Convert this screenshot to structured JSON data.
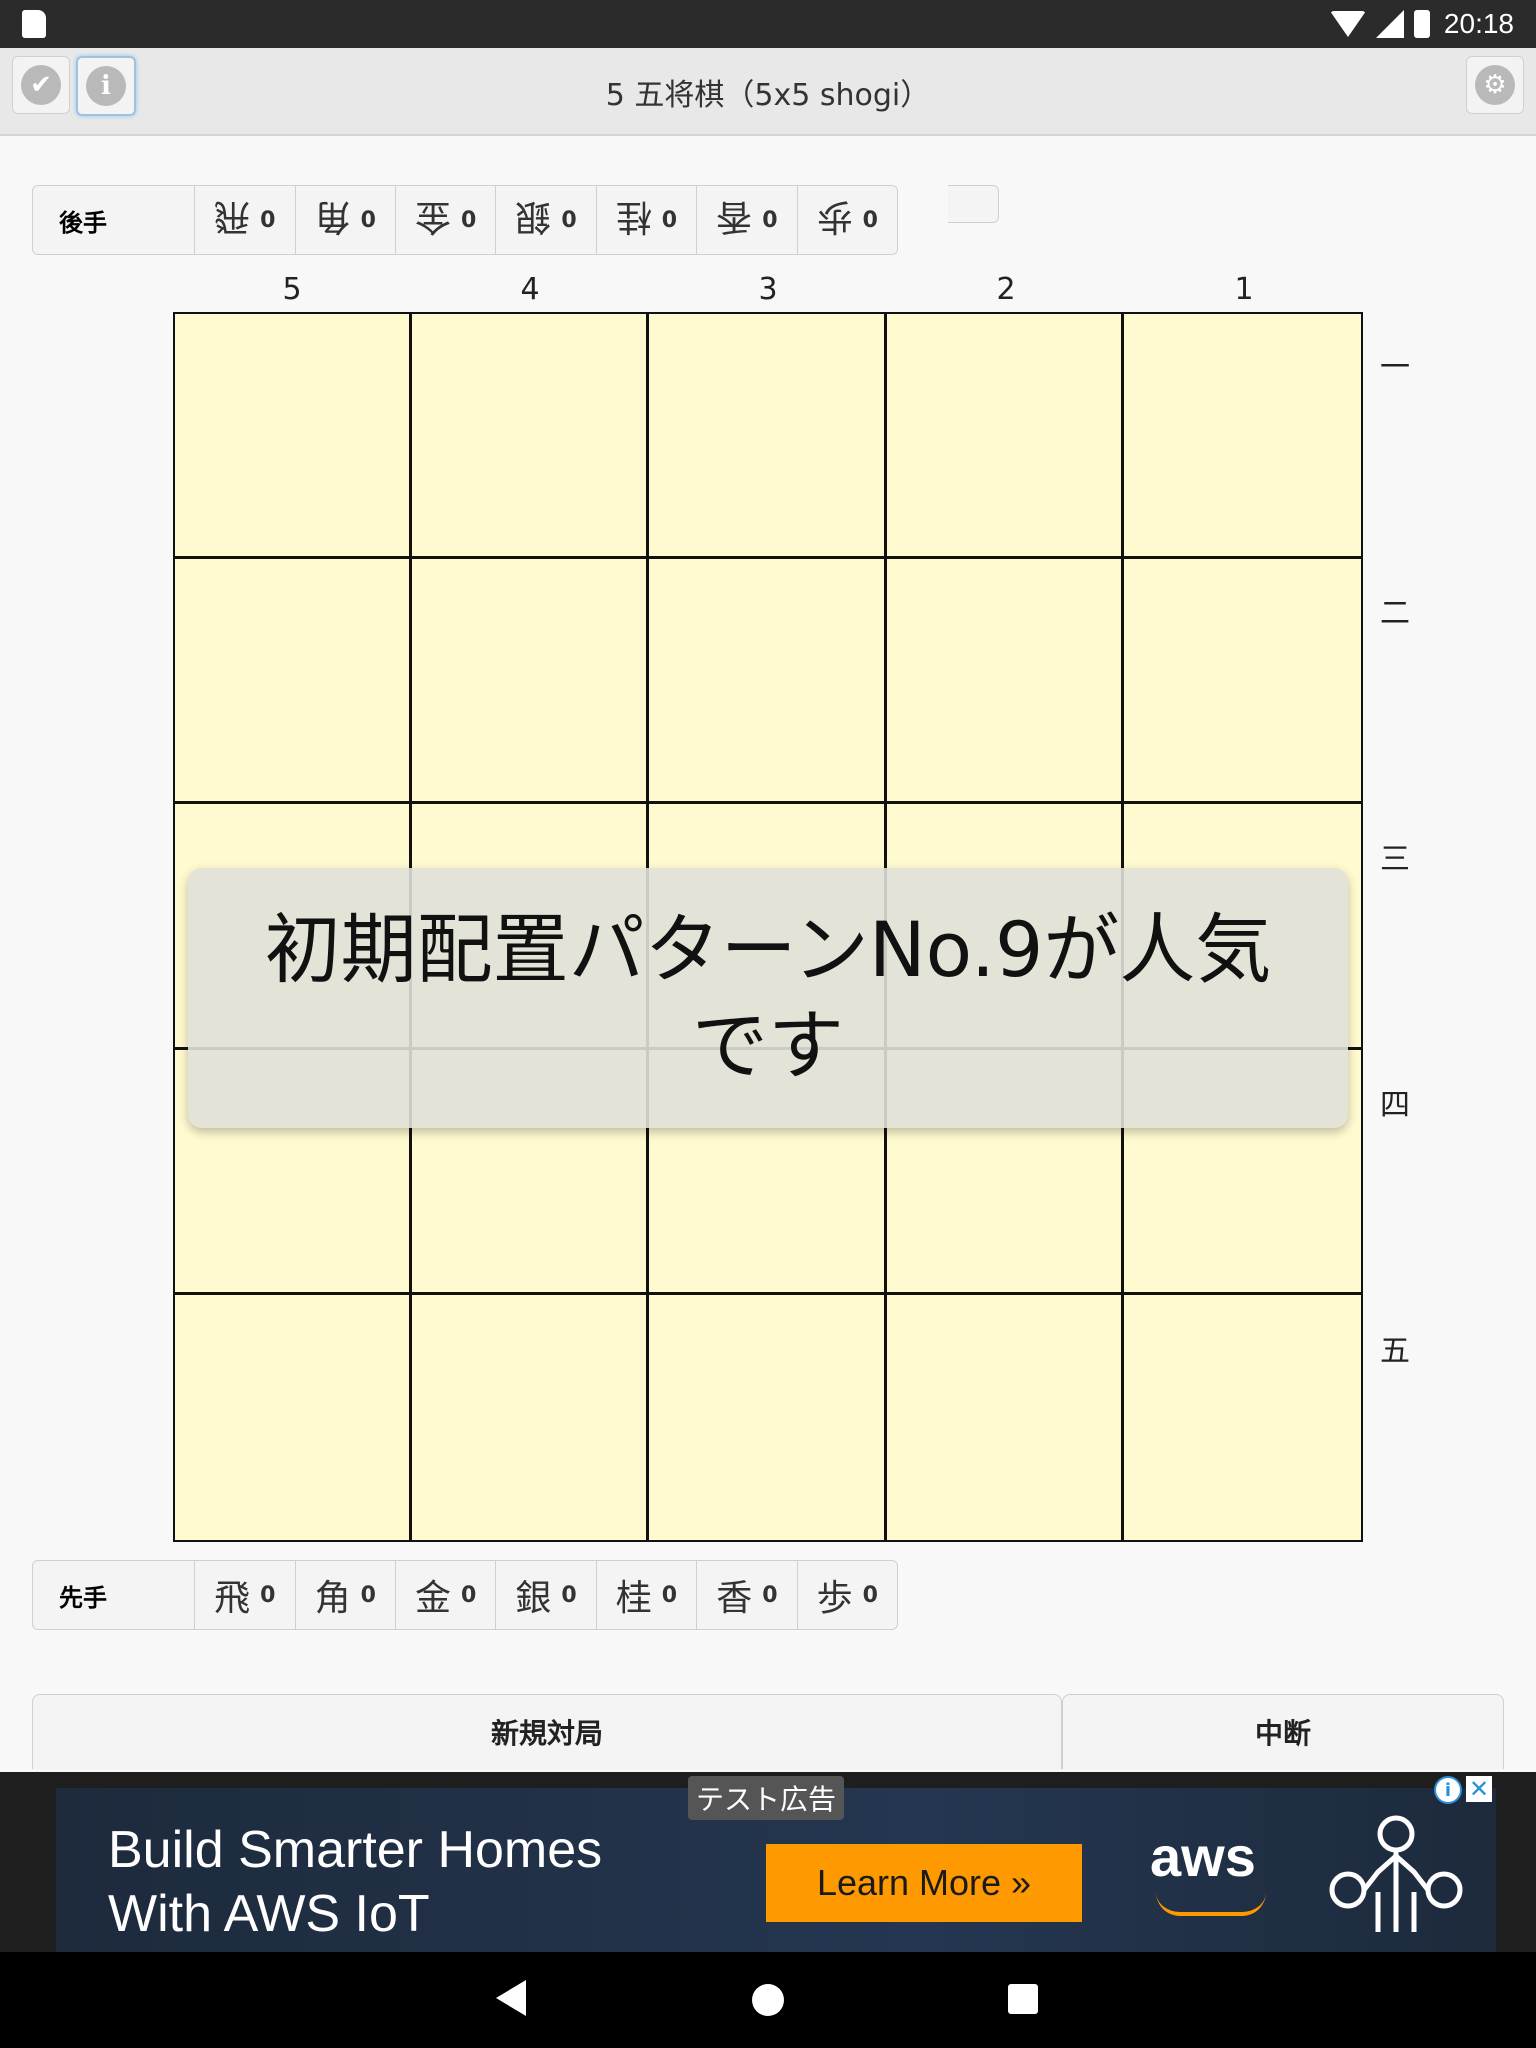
{
  "status_bar": {
    "time": "20:18"
  },
  "header": {
    "title": "5 五将棋（5x5 shogi）"
  },
  "gote_hand": {
    "player": "後手",
    "pieces": [
      {
        "name": "飛",
        "count": "0"
      },
      {
        "name": "角",
        "count": "0"
      },
      {
        "name": "金",
        "count": "0"
      },
      {
        "name": "銀",
        "count": "0"
      },
      {
        "name": "桂",
        "count": "0"
      },
      {
        "name": "香",
        "count": "0"
      },
      {
        "name": "歩",
        "count": "0"
      }
    ]
  },
  "board": {
    "columns": [
      "5",
      "4",
      "3",
      "2",
      "1"
    ],
    "rows": [
      "一",
      "二",
      "三",
      "四",
      "五"
    ],
    "background": "#fffad0"
  },
  "sente_hand": {
    "player": "先手",
    "pieces": [
      {
        "name": "飛",
        "count": "0"
      },
      {
        "name": "角",
        "count": "0"
      },
      {
        "name": "金",
        "count": "0"
      },
      {
        "name": "銀",
        "count": "0"
      },
      {
        "name": "桂",
        "count": "0"
      },
      {
        "name": "香",
        "count": "0"
      },
      {
        "name": "歩",
        "count": "0"
      }
    ]
  },
  "toast": {
    "message": "初期配置パターンNo.9が人気です"
  },
  "buttons": {
    "new_game": "新規対局",
    "suspend": "中断"
  },
  "ad": {
    "label": "テスト広告",
    "headline": "Build Smarter Homes With AWS IoT",
    "cta": "Learn More »",
    "logo": "aws",
    "cta_color": "#ff9900"
  }
}
